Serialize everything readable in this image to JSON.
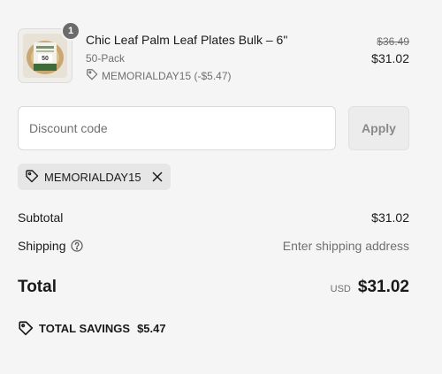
{
  "line_item": {
    "quantity": "1",
    "title": "Chic Leaf Palm Leaf Plates Bulk – 6\"",
    "variant": "50-Pack",
    "discount_label": "MEMORIALDAY15 (-$5.47)",
    "compare_price": "$36.49",
    "price": "$31.02",
    "thumb_text": "50"
  },
  "discount": {
    "placeholder": "Discount code",
    "apply_label": "Apply",
    "applied_code": "MEMORIALDAY15"
  },
  "summary": {
    "subtotal_label": "Subtotal",
    "subtotal_value": "$31.02",
    "shipping_label": "Shipping",
    "shipping_value": "Enter shipping address",
    "total_label": "Total",
    "currency": "USD",
    "total_value": "$31.02",
    "savings_label": "TOTAL SAVINGS",
    "savings_value": "$5.47"
  }
}
